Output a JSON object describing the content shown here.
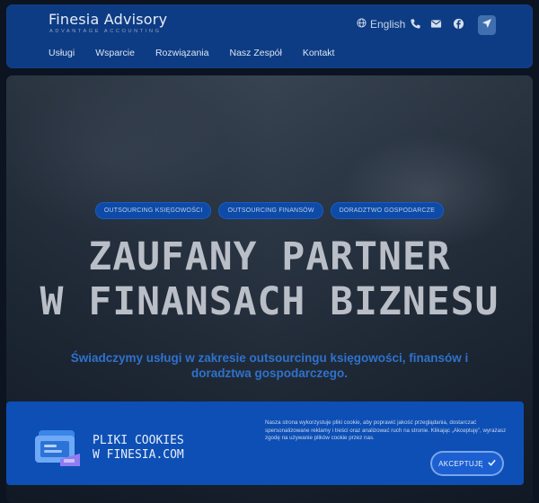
{
  "brand": {
    "name": "Finesia Advisory",
    "tagline": "ADVANTAGE ACCOUNTING"
  },
  "header": {
    "language": "English",
    "icons": [
      "globe-icon",
      "phone-icon",
      "mail-icon",
      "facebook-icon",
      "location-icon"
    ]
  },
  "nav": {
    "items": [
      "Usługi",
      "Wsparcie",
      "Rozwiązania",
      "Nasz Zespół",
      "Kontakt"
    ]
  },
  "hero": {
    "tags": [
      "OUTSOURCING KSIĘGOWOŚCI",
      "OUTSOURCING FINANSÓW",
      "DORADZTWO GOSPODARCZE"
    ],
    "headline_line1": "ZAUFANY PARTNER",
    "headline_line2": "W FINANSACH BIZNESU",
    "subheadline": "Świadczymy usługi w zakresie outsourcingu księgowości, finansów i doradztwa gospodarczego."
  },
  "cookie": {
    "title_line1": "PLIKI COOKIES",
    "title_line2": "W FINESIA.COM",
    "text": "Nasza strona wykorzystuje pliki cookie, aby poprawić jakość przeglądania, dostarczać spersonalizowane reklamy i treści oraz analizować ruch na stronie. Klikając „Akceptuję”, wyrażasz zgodę na używanie plików cookie przez nas.",
    "accept_label": "AKCEPTUJĘ"
  },
  "colors": {
    "header_bg": "#0d3c84",
    "accent": "#0d4fb5",
    "tag_bg": "#0e4aa7",
    "subheadline": "#2e72cc"
  }
}
